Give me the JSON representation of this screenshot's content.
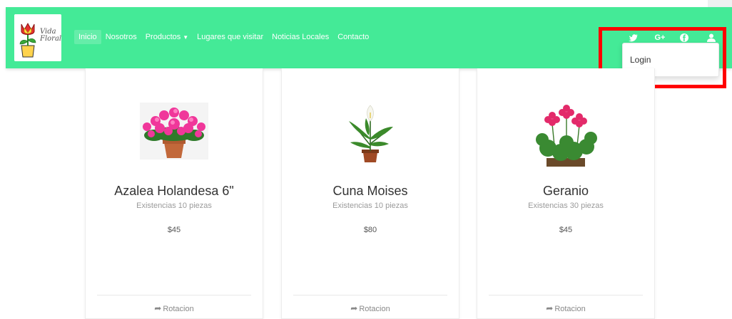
{
  "brand": {
    "logo_line1": "Vida",
    "logo_line2": "Floral"
  },
  "nav": {
    "items": [
      {
        "label": "Inicio",
        "active": true
      },
      {
        "label": "Nosotros"
      },
      {
        "label": "Productos",
        "caret": "▼"
      },
      {
        "label": "Lugares que visitar"
      },
      {
        "label": "Noticias Locales"
      },
      {
        "label": "Contacto"
      }
    ],
    "social": [
      {
        "icon": "twitter-icon",
        "glyph": "🐦"
      },
      {
        "icon": "google-plus-icon",
        "glyph": "G+"
      },
      {
        "icon": "facebook-icon",
        "glyph": "f"
      },
      {
        "icon": "user-icon",
        "glyph": "👤"
      }
    ]
  },
  "dropdown": {
    "login_label": "Login"
  },
  "products": [
    {
      "name": "Azalea Holandesa 6\"",
      "stock": "Existencias 10 piezas",
      "price": "$45",
      "action": "Rotacion"
    },
    {
      "name": "Cuna Moises",
      "stock": "Existencias 10 piezas",
      "price": "$80",
      "action": "Rotacion"
    },
    {
      "name": "Geranio",
      "stock": "Existencias 30 piezas",
      "price": "$45",
      "action": "Rotacion"
    }
  ],
  "colors": {
    "navbar": "#44ea97",
    "highlight": "#ff0000",
    "card_bg": "#ffffff"
  }
}
